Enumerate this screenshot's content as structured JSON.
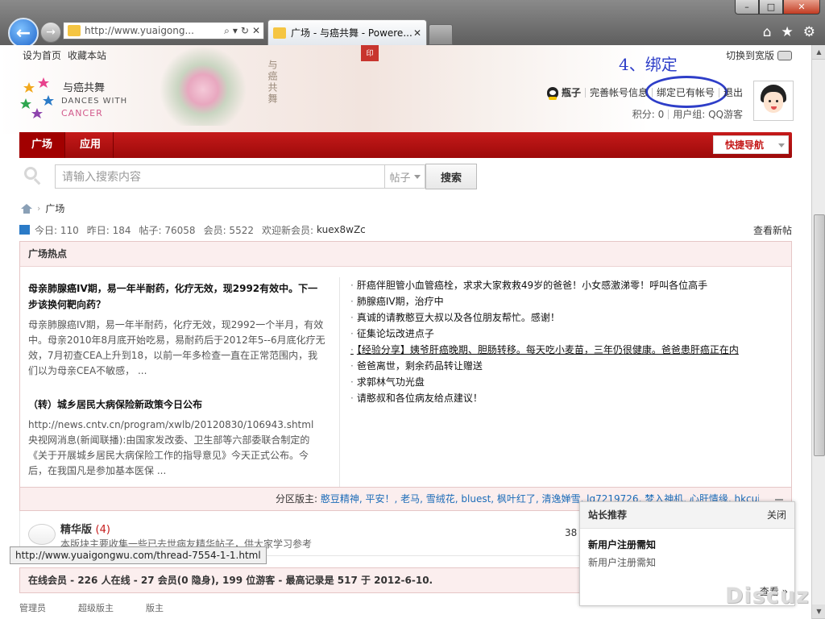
{
  "browser": {
    "address_url": "http://www.yuaigong...",
    "tab_title": "广场 - 与癌共舞 - Powere...",
    "window_controls": {
      "minimize": "–",
      "maximize": "□",
      "close": "✕"
    },
    "icons": [
      "back-arrow-icon",
      "forward-arrow-icon",
      "search-icon",
      "refresh-icon",
      "stop-icon",
      "home-icon",
      "star-icon",
      "gear-icon"
    ]
  },
  "site": {
    "top_links": {
      "set_home": "设为首页",
      "bookmark": "收藏本站"
    },
    "switch_width": "切换到宽版",
    "logo": {
      "cn": "与癌共舞",
      "en_line1": "DANCES WITH",
      "en_line2": "CANCER"
    },
    "header_calligraphy": "与癌共舞",
    "seal_text": "印",
    "annotation": "4、绑定",
    "user": {
      "name": "瓶子",
      "links": [
        "完善帐号信息",
        "绑定已有帐号",
        "退出"
      ],
      "points": "积分: 0",
      "group": "用户组: QQ游客"
    },
    "nav": {
      "items": [
        "广场",
        "应用"
      ],
      "quick_nav": "快捷导航"
    },
    "search": {
      "placeholder": "请输入搜索内容",
      "type": "帖子",
      "button": "搜索"
    },
    "breadcrumb": [
      "广场"
    ],
    "stats": {
      "today": "今日: 110",
      "yesterday": "昨日: 184",
      "posts": "帖子: 76058",
      "members": "会员: 5522",
      "welcome": "欢迎新会员:",
      "new_member": "kuex8wZc",
      "view_new": "查看新帖"
    },
    "hot": {
      "title": "广场热点",
      "featured": [
        {
          "title": "母亲肺腺癌IV期，易一年半耐药，化疗无效，现2992有效中。下一步该换何靶向药？",
          "summary": "母亲肺腺癌IV期，易一年半耐药，化疗无效，现2992一个半月，有效中。母亲2010年8月底开始吃易，易耐药后于2012年5--6月底化疗无效，7月初查CEA上升到18，以前一年多检查一直在正常范围内，我们以为母亲CEA不敏感， ..."
        },
        {
          "title": "（转）城乡居民大病保险新政策今日公布",
          "summary": "http://news.cntv.cn/program/xwlb/20120830/106943.shtml 央视网消息(新闻联播):由国家发改委、卫生部等六部委联合制定的《关于开展城乡居民大病保险工作的指导意见》今天正式公布。今后，在我国凡是参加基本医保 ..."
        }
      ],
      "list": [
        "肝癌伴胆管小血管癌栓，求求大家救救49岁的爸爸！小女感激涕零！呼叫各位高手",
        "肺腺癌IV期，治疗中",
        "真诚的请教憨豆大叔以及各位朋友帮忙。感谢！",
        "征集论坛改进点子",
        "【经验分享】姨爷肝癌晚期、胆肠转移。每天吃小麦苗，三年仍很健康。爸爸患肝癌正在内",
        "爸爸离世，剩余药品转让赠送",
        "求郭林气功光盘",
        "请憨叔和各位病友给点建议！"
      ]
    },
    "moderators": {
      "label": "分区版主:",
      "names": "憨豆精神, 平安！, 老马, 雪绒花, bluest, 枫叶红了, 清逸婵雪, lg7219726, 梦入神机, 心肝情缘, hkcui"
    },
    "forum": {
      "name": "精华版",
      "count": "(4)",
      "desc": "本版块主要收集一些已去世病友精华帖子，供大家学习参考",
      "number": "38"
    },
    "online": "在线会员 - 226 人在线 - 27 会员(0 隐身), 199 位游客 - 最高记录是 517 于 2012-6-10.",
    "bottom_labels": [
      "管理员",
      "超级版主",
      "版主"
    ],
    "status_url": "http://www.yuaigongwu.com/thread-7554-1-1.html",
    "popup": {
      "title": "站长推荐",
      "close": "关闭",
      "item_title": "新用户注册需知",
      "item_sub": "新用户注册需知",
      "more": "查看 »"
    },
    "watermark": "Discuz!"
  },
  "colors": {
    "nav_red": "#c51a1a",
    "annotation_blue": "#2e3ec8",
    "link_blue": "#1c6cb8"
  }
}
